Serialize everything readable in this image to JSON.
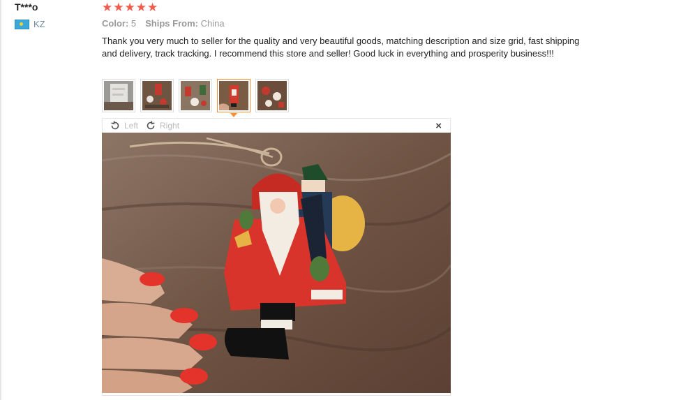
{
  "review": {
    "reviewer": "T***o",
    "country_code": "KZ",
    "rating": 5,
    "stars": [
      "★",
      "★",
      "★",
      "★",
      "★"
    ],
    "color_label": "Color:",
    "color_value": "5",
    "ships_label": "Ships From:",
    "ships_value": "China",
    "text": "Thank you very much to seller for the quality and very beautiful goods, matching description and size grid, fast shipping and delivery, track tracking. I recommend this store and seller! Good luck in everything and prosperity business!!!"
  },
  "viewer": {
    "rotate_left_label": "Left",
    "rotate_right_label": "Right",
    "close_label": "×"
  },
  "colors": {
    "star": "#f25a4c",
    "active_thumb": "#f58e3b",
    "muted": "#999999"
  }
}
